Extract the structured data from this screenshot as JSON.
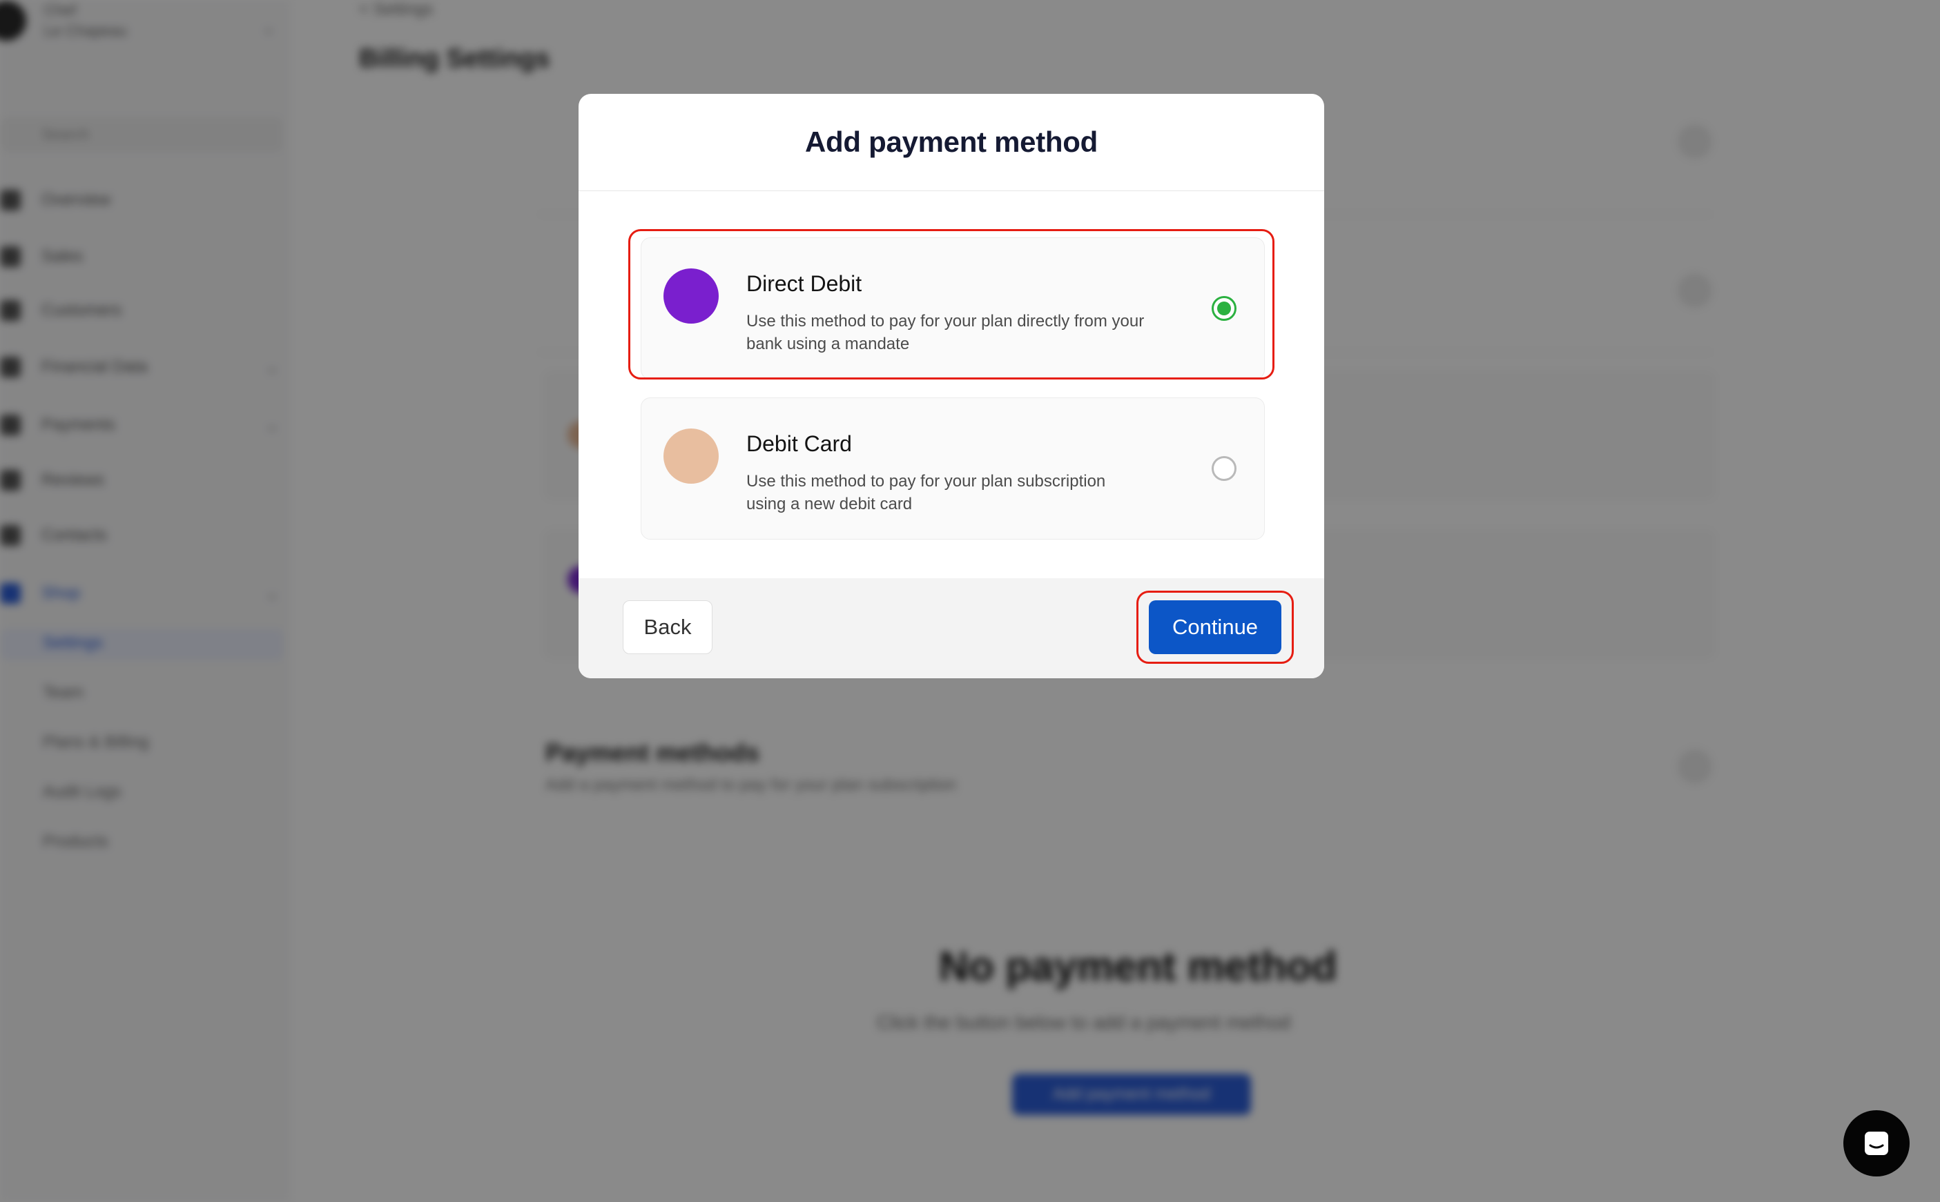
{
  "background": {
    "profile_name": "Chef",
    "profile_sub": "Le Chapeau",
    "search_placeholder": "Search",
    "sidebar_items": [
      "Overview",
      "Sales",
      "Customers",
      "Financial Data",
      "Payments",
      "Reviews",
      "Contacts",
      "Shop"
    ],
    "settings_label": "Settings",
    "settings_sub": [
      "Team",
      "Plans & Billing",
      "Audit Logs",
      "Products"
    ],
    "breadcrumb": "< Settings",
    "page_title": "Billing Settings",
    "section_heading": "Payment methods",
    "section_desc": "Add a payment method to pay for your plan subscription",
    "empty_title": "No payment method",
    "empty_desc": "Click the button below to add a payment method",
    "empty_button": "Add payment method"
  },
  "modal": {
    "title": "Add payment method",
    "options": [
      {
        "name": "Direct Debit",
        "description": "Use this method to pay for your plan directly from your bank using a mandate",
        "color": "#7a1fce",
        "selected": true
      },
      {
        "name": "Debit Card",
        "description": "Use this method to pay for your plan subscription using a new debit card",
        "color": "#e8be9f",
        "selected": false
      }
    ],
    "back_label": "Back",
    "continue_label": "Continue"
  },
  "colors": {
    "accent": "#0c56c7",
    "selected_radio": "#2bb140",
    "highlight": "#e61d12"
  },
  "chat": {
    "icon": "chat-icon"
  }
}
